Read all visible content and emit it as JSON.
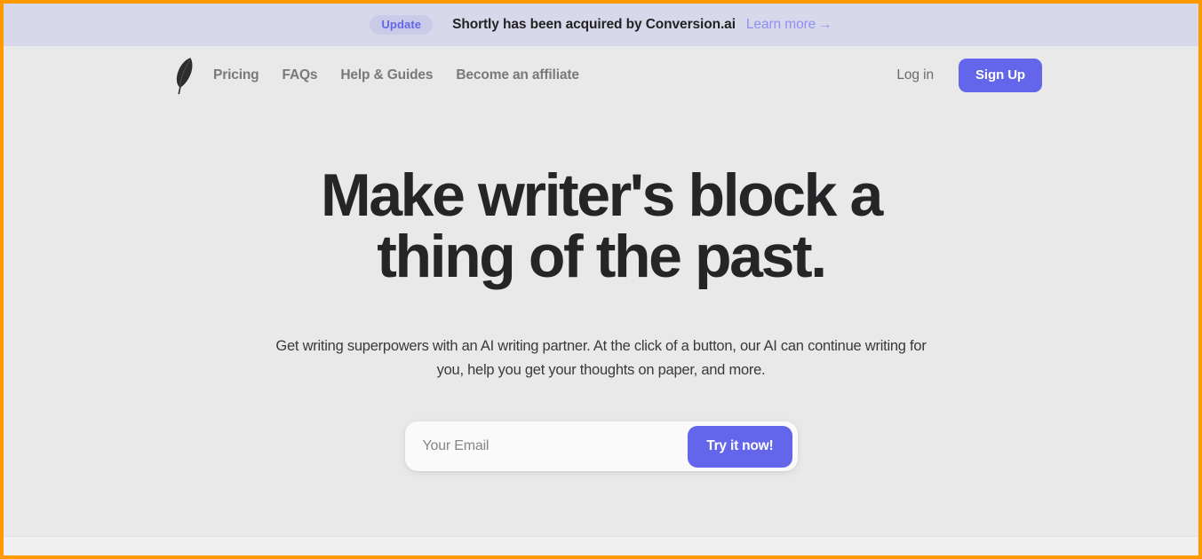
{
  "announcement": {
    "badge_label": "Update",
    "message": "Shortly has been acquired by Conversion.ai",
    "link_label": "Learn more",
    "link_arrow": "→",
    "bg_color": "#d7d8ea",
    "badge_bg_color": "#c9cbe8",
    "badge_text_color": "#6366e8",
    "link_color": "#8f90ef"
  },
  "nav": {
    "logo_name": "feather-quill-logo",
    "links": [
      {
        "label": "Pricing"
      },
      {
        "label": "FAQs"
      },
      {
        "label": "Help & Guides"
      },
      {
        "label": "Become an affiliate"
      }
    ],
    "login_label": "Log in",
    "signup_label": "Sign Up",
    "link_color": "#79797c",
    "accent_color": "#6366ea"
  },
  "hero": {
    "title": "Make writer's block a thing of the past.",
    "subtitle": "Get writing superpowers with an AI writing partner. At the click of a button, our AI can continue writing for you, help you get your thoughts on paper, and more.",
    "title_color": "#252527",
    "subtitle_color": "#3a3a3d"
  },
  "signup_form": {
    "email_placeholder": "Your Email",
    "email_value": "",
    "submit_label": "Try it now!",
    "submit_color": "#6366ea",
    "field_bg_color": "#fafafa"
  },
  "page": {
    "background_color": "#e9e9e9",
    "lower_strip_color": "#f0f0f0"
  }
}
